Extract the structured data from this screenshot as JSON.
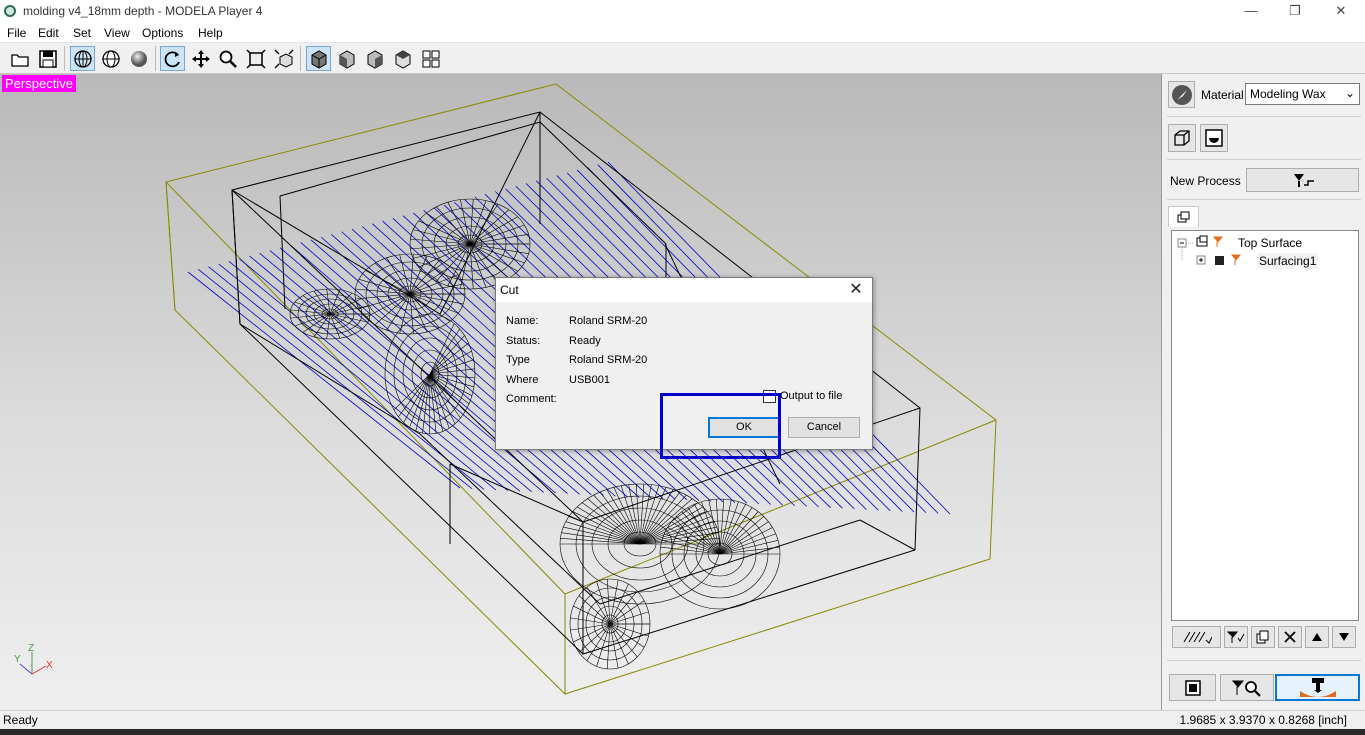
{
  "window": {
    "title": "molding v4_18mm depth  - MODELA Player 4",
    "minimize": "—",
    "restore": "❐",
    "close": "✕"
  },
  "menu": [
    "File",
    "Edit",
    "Set",
    "View",
    "Options",
    "Help"
  ],
  "viewport": {
    "view_label": "Perspective",
    "axis_labels": {
      "z": "Z",
      "y": "Y",
      "x": "X"
    }
  },
  "dialog": {
    "title": "Cut",
    "close": "✕",
    "fields": [
      {
        "label": "Name:",
        "value": "Roland SRM-20"
      },
      {
        "label": "Status:",
        "value": "Ready"
      },
      {
        "label": "Type",
        "value": "Roland SRM-20"
      },
      {
        "label": "Where",
        "value": "USB001"
      },
      {
        "label": "Comment:",
        "value": ""
      }
    ],
    "output_to_file": {
      "label": "Output to file",
      "checked": false
    },
    "ok": "OK",
    "cancel": "Cancel"
  },
  "panel": {
    "material_label": "Material",
    "material_value": "Modeling Wax",
    "new_process_label": "New Process",
    "tree": [
      {
        "label": "Top Surface"
      },
      {
        "label": "Surfacing1"
      }
    ]
  },
  "status": {
    "left": "Ready",
    "right": "1.9685 x 3.9370 x 0.8268 [inch]"
  },
  "colors": {
    "view_label_bg": "#ff00ff",
    "wire": "#000000",
    "toolpath": "#0000cc",
    "bbox": "#8a8a00",
    "accent": "#0078d7"
  }
}
